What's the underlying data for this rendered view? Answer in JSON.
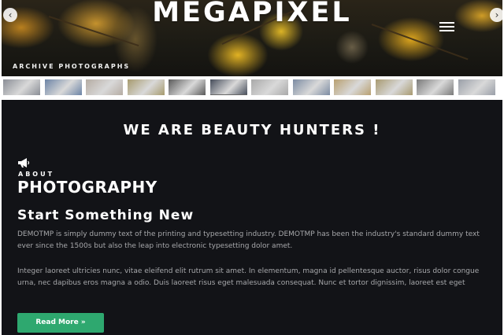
{
  "hero": {
    "title": "MEGAPIXEL",
    "subtitle": "ARCHIVE PHOTOGRAPHS",
    "prev_arrow": "‹",
    "next_arrow": "›"
  },
  "thumbnails": {
    "count": 12,
    "active_index": 5,
    "colors": [
      "#8a8e96",
      "#6c84a6",
      "#b5aca3",
      "#a79b6e",
      "#5a5a5a",
      "#454c5a",
      "#a9a9a9",
      "#7c8ca3",
      "#b8a070",
      "#a89a70",
      "#7a7a7a",
      "#9a9fa8"
    ]
  },
  "main": {
    "headline": "WE ARE BEAUTY HUNTERS !",
    "about_label": "ABOUT",
    "about_heading": "PHOTOGRAPHY",
    "section_heading": "Start Something New",
    "paragraph1": "DEMOTMP is simply dummy text of the printing and typesetting industry. DEMOTMP has been the industry's standard dummy text ever since the 1500s but also the leap into electronic typesetting dolor amet.",
    "paragraph2": "Integer laoreet ultricies nunc, vitae eleifend elit rutrum sit amet. In elementum, magna id pellentesque auctor, risus dolor congue urna, nec dapibus eros magna a odio. Duis laoreet risus eget malesuada consequat. Nunc et tortor dignissim, laoreet est eget",
    "read_more_label": "Read More »"
  },
  "colors": {
    "main_background": "#121317",
    "accent_button": "#2ea86f",
    "body_text": "#a7a8ab"
  },
  "icons": {
    "menu": "hamburger-menu-icon",
    "about": "megaphone-icon"
  }
}
